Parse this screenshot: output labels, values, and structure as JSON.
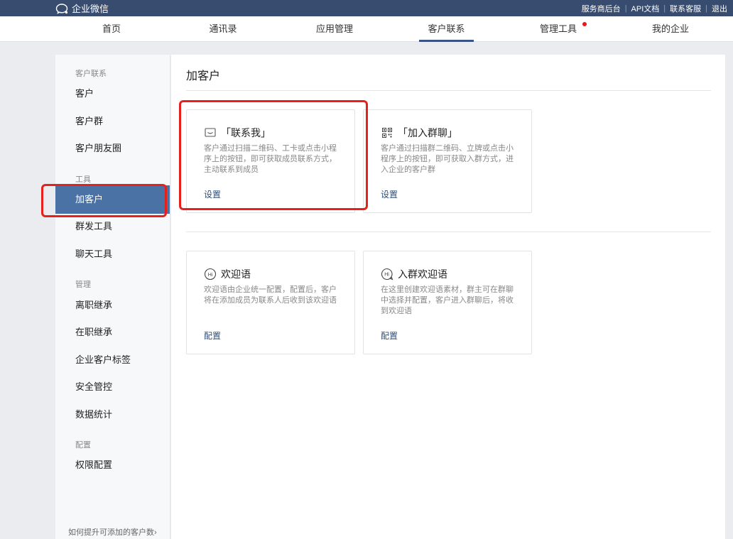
{
  "topbar": {
    "logo_text": "企业微信",
    "links": [
      "服务商后台",
      "API文档",
      "联系客服",
      "退出"
    ]
  },
  "nav": {
    "items": [
      "首页",
      "通讯录",
      "应用管理",
      "客户联系",
      "管理工具",
      "我的企业"
    ],
    "active_index": 3
  },
  "sidebar": {
    "groups": {
      "customer_contact": "客户联系",
      "tools": "工具",
      "manage": "管理",
      "config": "配置"
    },
    "items": {
      "customer": "客户",
      "customer_group": "客户群",
      "moments": "客户朋友圈",
      "add_customer": "加客户",
      "mass_send": "群发工具",
      "chat_tools": "聊天工具",
      "resigned_transfer": "离职继承",
      "onjob_transfer": "在职继承",
      "tags": "企业客户标签",
      "security": "安全管控",
      "stats": "数据统计",
      "permissions": "权限配置"
    },
    "footer": "如何提升可添加的客户数"
  },
  "main": {
    "title": "加客户",
    "cards": [
      {
        "title": "「联系我」",
        "icon": "contact-me-icon",
        "desc": "客户通过扫描二维码、工卡或点击小程序上的按钮，即可获取成员联系方式，主动联系到成员",
        "action": "设置"
      },
      {
        "title": "「加入群聊」",
        "icon": "qrcode-icon",
        "desc": "客户通过扫描群二维码、立牌或点击小程序上的按钮，即可获取入群方式，进入企业的客户群",
        "action": "设置"
      },
      {
        "title": "欢迎语",
        "icon": "hi-bubble-icon",
        "desc": "欢迎语由企业统一配置，配置后，客户将在添加成员为联系人后收到该欢迎语",
        "action": "配置"
      },
      {
        "title": "入群欢迎语",
        "icon": "hi-bubble-icon",
        "desc": "在这里创建欢迎语素材，群主可在群聊中选择并配置，客户进入群聊后，将收到欢迎语",
        "action": "配置"
      }
    ]
  },
  "colors": {
    "topbar": "#374c6e",
    "active_side": "#4a72a5",
    "highlight": "#e8201c",
    "notify_dot": "#e21b1b"
  }
}
